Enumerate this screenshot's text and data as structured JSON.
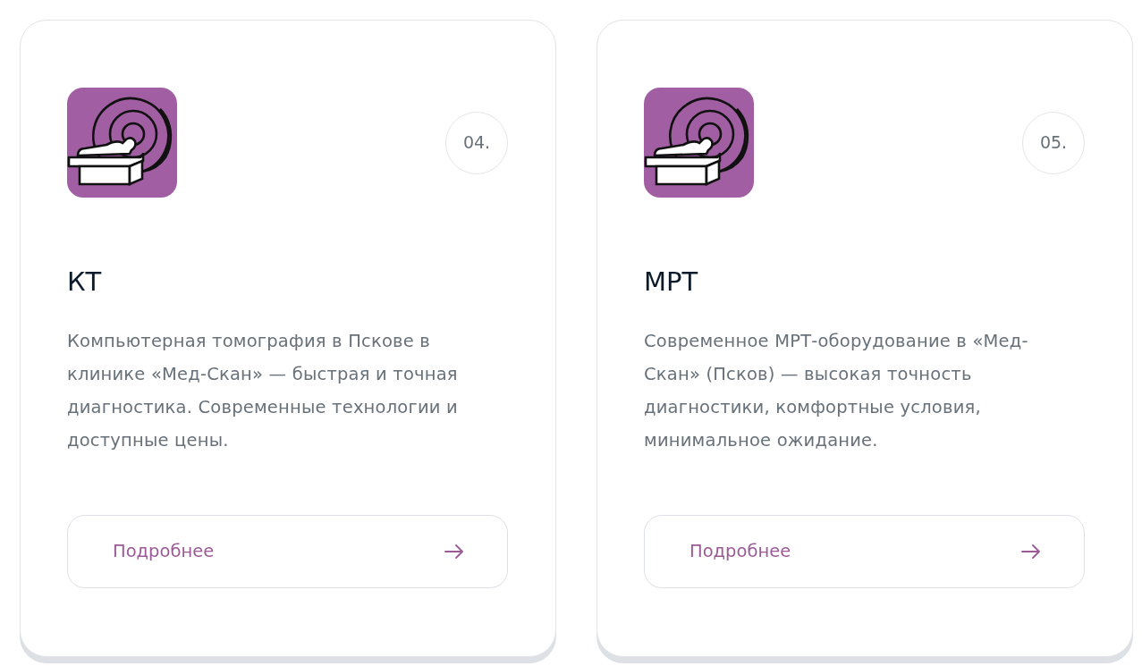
{
  "cards": [
    {
      "number": "04.",
      "title": "КТ",
      "description": "Компьютерная томография в Пскове в клинике «Мед-Скан» — быстрая и точная диагностика. Современные технологии и доступные цены.",
      "button": {
        "label": "Подробнее"
      }
    },
    {
      "number": "05.",
      "title": "МРТ",
      "description": "Современное МРТ-оборудование в «Мед-Скан» (Псков) — высокая точность диагностики, комфортные условия, минимальное ожидание.",
      "button": {
        "label": "Подробнее"
      }
    }
  ]
}
